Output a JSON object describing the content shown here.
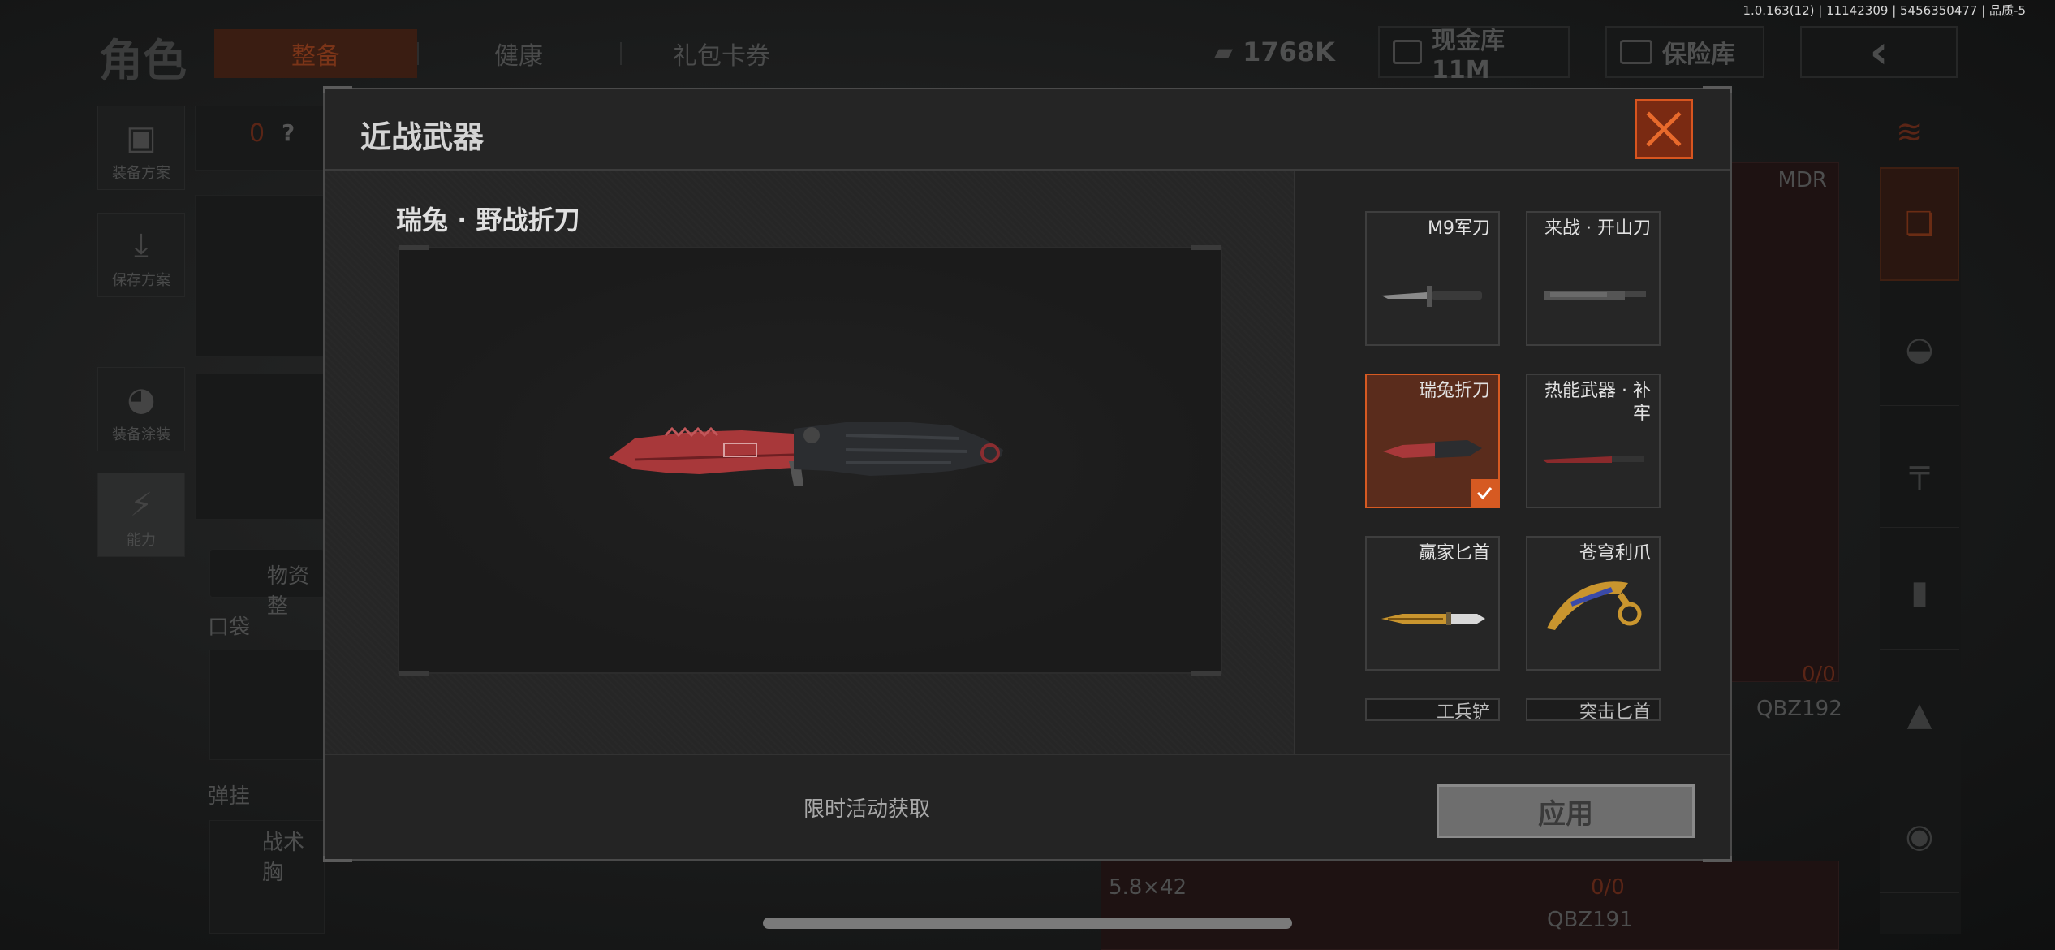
{
  "version_info": "1.0.163(12) | 11142309 | 5456350477 | 品质-5",
  "background": {
    "role_title": "角色",
    "tabs": [
      {
        "label": "整备",
        "active": true
      },
      {
        "label": "健康",
        "active": false
      },
      {
        "label": "礼包卡券",
        "active": false
      }
    ],
    "currency": "1768K",
    "cash_vault": "现金库 11M",
    "insurance_vault": "保险库",
    "side_buttons": [
      {
        "label": "装备方案"
      },
      {
        "label": "保存方案"
      },
      {
        "label": "装备涂装"
      },
      {
        "label": "能力"
      }
    ],
    "armor_count": "0",
    "help": "?",
    "supplies_label": "物资整",
    "pocket_label": "口袋",
    "rig_label": "弹挂",
    "vest_label": "战术胸",
    "weapon_mdr": "MDR",
    "ammo_count_1": "0/0",
    "weapon_qbz192": "QBZ192",
    "ammo_type": "5.8×42",
    "ammo_count_2": "0/0",
    "weapon_qbz191": "QBZ191"
  },
  "modal": {
    "title": "近战武器",
    "selected_name": "瑞兔 · 野战折刀",
    "items": [
      {
        "name": "M9军刀",
        "selected": false,
        "icon": "bayonet-icon"
      },
      {
        "name": "来战 · 开山刀",
        "selected": false,
        "icon": "machete-icon"
      },
      {
        "name": "瑞兔折刀",
        "selected": true,
        "icon": "red-folding-knife-icon"
      },
      {
        "name": "热能武器 · 补牢",
        "selected": false,
        "icon": "thermal-blade-icon"
      },
      {
        "name": "赢家匕首",
        "selected": false,
        "icon": "gold-dagger-icon"
      },
      {
        "name": "苍穹利爪",
        "selected": false,
        "icon": "karambit-icon"
      },
      {
        "name": "工兵铲",
        "selected": false,
        "icon": "shovel-icon"
      },
      {
        "name": "突击匕首",
        "selected": false,
        "icon": "assault-dagger-icon"
      }
    ],
    "source_text": "限时活动获取",
    "apply_label": "应用"
  },
  "colors": {
    "accent": "#d65a22",
    "selected_bg": "#5a2c1c",
    "knife_red": "#a8383a",
    "handle_dark": "#2b2d30"
  }
}
